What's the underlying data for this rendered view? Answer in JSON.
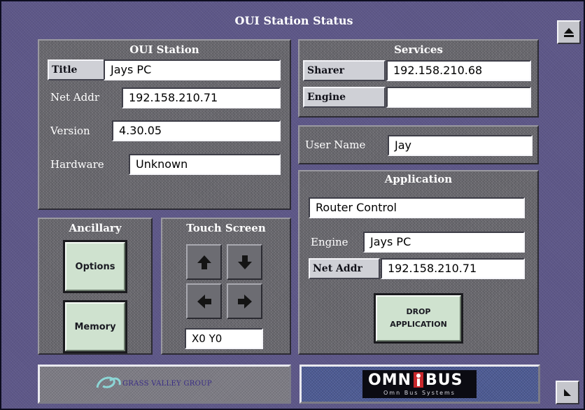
{
  "window": {
    "title": "OUI Station Status"
  },
  "oui_station": {
    "heading": "OUI Station",
    "title_label": "Title",
    "title_value": "Jays PC",
    "net_addr_label": "Net Addr",
    "net_addr_value": "192.158.210.71",
    "version_label": "Version",
    "version_value": "4.30.05",
    "hardware_label": "Hardware",
    "hardware_value": "Unknown"
  },
  "services": {
    "heading": "Services",
    "sharer_label": "Sharer",
    "sharer_value": "192.158.210.68",
    "engine_label": "Engine",
    "engine_value": ""
  },
  "user": {
    "label": "User Name",
    "value": "Jay"
  },
  "application": {
    "heading": "Application",
    "name_value": "Router Control",
    "engine_label": "Engine",
    "engine_value": "Jays PC",
    "net_addr_label": "Net Addr",
    "net_addr_value": "192.158.210.71",
    "drop_line1": "DROP",
    "drop_line2": "APPLICATION"
  },
  "ancillary": {
    "heading": "Ancillary",
    "options_label": "Options",
    "memory_label": "Memory"
  },
  "touch_screen": {
    "heading": "Touch Screen",
    "coords": "X0 Y0"
  },
  "logos": {
    "gvg_text": "GRASS VALLEY GROUP",
    "omnibus_text_left": "OMN",
    "omnibus_text_right": "BUS",
    "omnibus_sub": "Omn Bus Systems"
  },
  "icons": {
    "eject": "eject-icon",
    "resize": "resize-corner-icon",
    "up": "arrow-up-icon",
    "down": "arrow-down-icon",
    "left": "arrow-left-icon",
    "right": "arrow-right-icon"
  },
  "colors": {
    "background": "#5d5788",
    "panel": "#67666c",
    "field": "#ffffff",
    "button_green": "#cfe2cf"
  }
}
